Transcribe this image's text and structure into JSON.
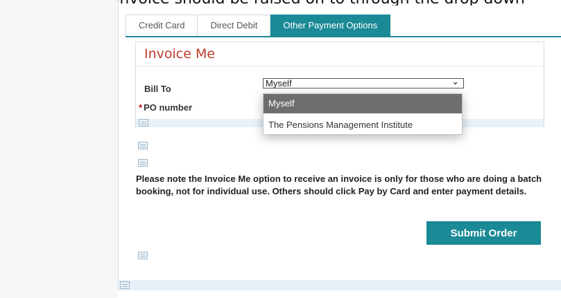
{
  "caption": "which the invoice should be raised on to through the drop down",
  "tabs": [
    {
      "label": "Credit Card"
    },
    {
      "label": "Direct Debit"
    },
    {
      "label": "Other Payment Options"
    }
  ],
  "invoice": {
    "title": "Invoice Me",
    "bill_to_label": "Bill To",
    "po_label": "PO number",
    "required_marker": "*",
    "bill_to_value": "Myself",
    "dropdown_options": [
      "Myself",
      "The Pensions Management Institute"
    ]
  },
  "note": "Please note the Invoice Me option to receive an invoice is only for those who are doing a batch booking, not for individual use. Others should click Pay by Card and enter payment details.",
  "submit_label": "Submit Order",
  "colors": {
    "accent": "#1a8a96",
    "title_red": "#c0392b",
    "required_red": "#d0021b"
  }
}
